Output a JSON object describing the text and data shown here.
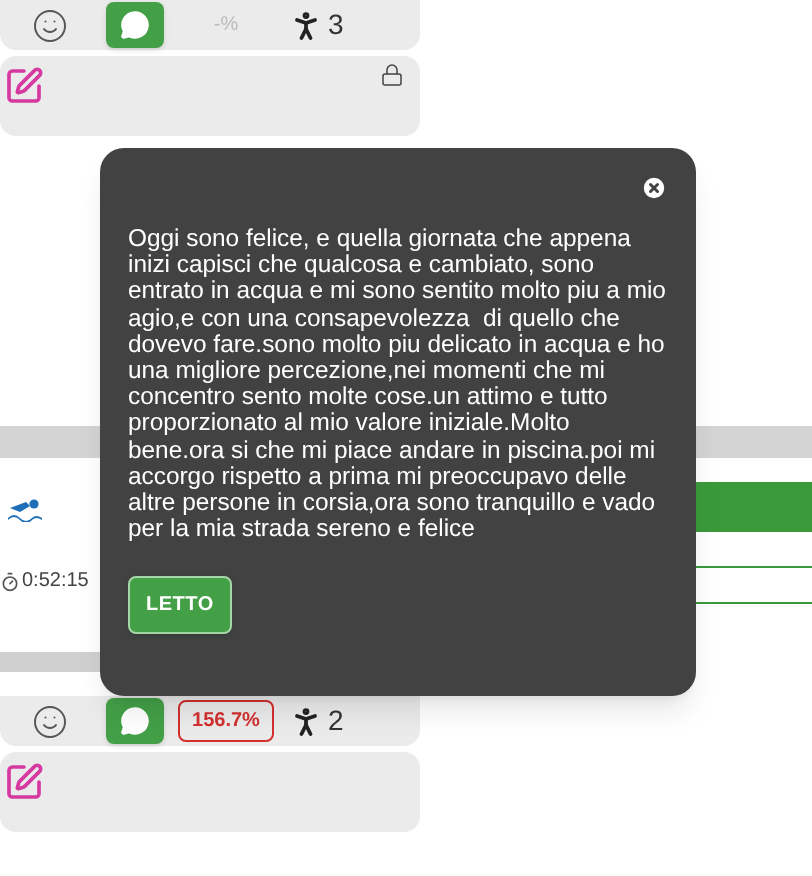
{
  "top_stats": {
    "comment_active": true,
    "percent": "-%",
    "percent_available": false,
    "participants": "3"
  },
  "top_note": {
    "locked": true
  },
  "session": {
    "time": "0:52:15"
  },
  "bottom_stats": {
    "comment_active": true,
    "percent": "156.7%",
    "percent_available": true,
    "participants": "2"
  },
  "bottom_note": {
    "locked": false
  },
  "popup": {
    "text": "Oggi sono felice, e quella giornata che appena inizi capisci che qualcosa e cambiato, sono entrato in acqua e mi sono sentito molto piu a mio agio,e con una consapevolezza  di quello che dovevo fare.sono molto piu delicato in acqua e ho una migliore percezione,nei momenti che mi concentro sento molte cose.un attimo e tutto proporzionato al mio valore iniziale.Molto bene.ora si che mi piace andare in piscina.poi mi accorgo rispetto a prima mi preoccupavo delle altre persone in corsia,ora sono tranquillo e vado per la mia strada sereno e felice",
    "button": "LETTO"
  }
}
